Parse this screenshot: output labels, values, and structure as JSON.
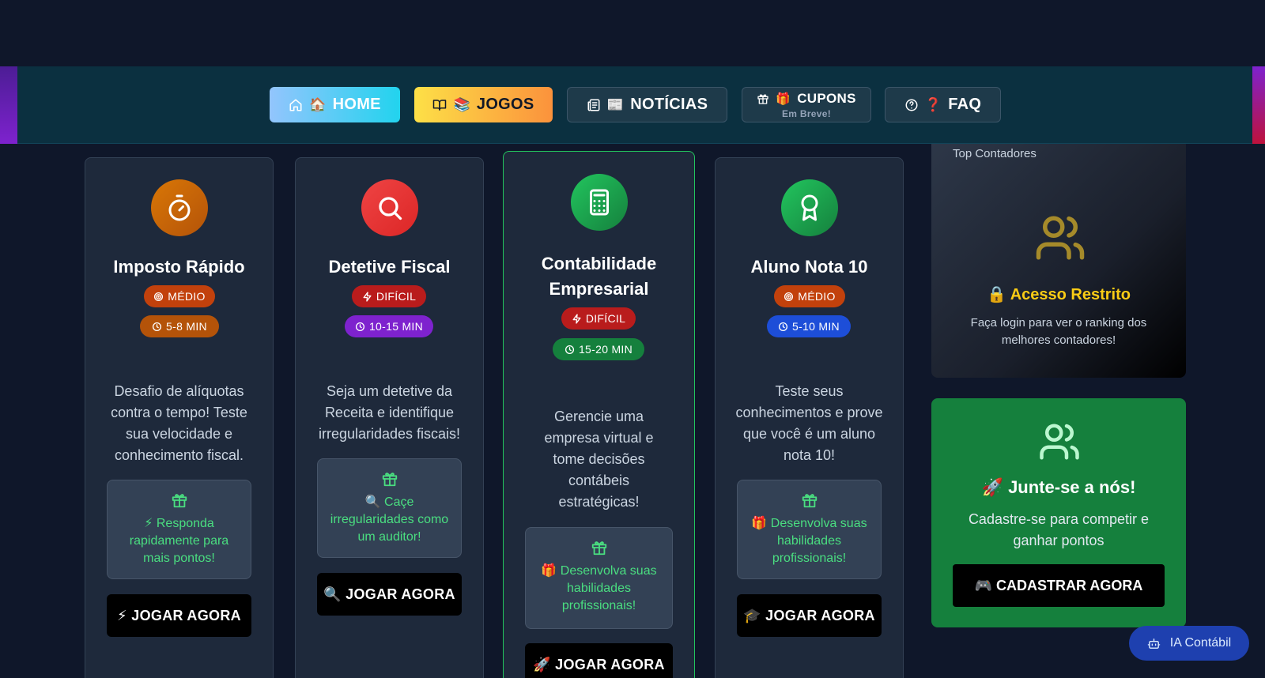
{
  "nav": {
    "home": {
      "emoji": "🏠",
      "label": "HOME"
    },
    "jogos": {
      "emoji": "📚",
      "label": "JOGOS"
    },
    "noticias": {
      "emoji": "📰",
      "label": "NOTÍCIAS"
    },
    "cupons": {
      "emoji": "🎁",
      "label": "CUPONS",
      "sublabel": "Em Breve!"
    },
    "faq": {
      "emoji": "❓",
      "label": "FAQ"
    }
  },
  "games": [
    {
      "title": "Imposto Rápido",
      "difficulty": "MÉDIO",
      "duration": "5-8 MIN",
      "description": "Desafio de alíquotas contra o tempo! Teste sua velocidade e conhecimento fiscal.",
      "tip": "⚡ Responda rapidamente para mais pontos!",
      "button": "⚡ JOGAR AGORA",
      "icon": "stopwatch-icon",
      "icon_color": "#ca8a04"
    },
    {
      "title": "Detetive Fiscal",
      "difficulty": "DIFÍCIL",
      "duration": "10-15 MIN",
      "description": "Seja um detetive da Receita e identifique irregularidades fiscais!",
      "tip": "🔍 Caçe irregularidades como um auditor!",
      "button": "🔍 JOGAR AGORA",
      "icon": "search-icon",
      "icon_color": "#dc2626"
    },
    {
      "title": "Contabilidade Empresarial",
      "difficulty": "DIFÍCIL",
      "duration": "15-20 MIN",
      "description": "Gerencie uma empresa virtual e tome decisões contábeis estratégicas!",
      "tip": "🎁 Desenvolva suas habilidades profissionais!",
      "button": "🚀 JOGAR AGORA",
      "icon": "calculator-icon",
      "icon_color": "#16a34a"
    },
    {
      "title": "Aluno Nota 10",
      "difficulty": "MÉDIO",
      "duration": "5-10 MIN",
      "description": "Teste seus conhecimentos e prove que você é um aluno nota 10!",
      "tip": "🎁 Desenvolva suas habilidades profissionais!",
      "button": "🎓 JOGAR AGORA",
      "icon": "award-icon",
      "icon_color": "#16a34a"
    }
  ],
  "ranking": {
    "label": "Top Contadores",
    "title": "🔒 Acesso Restrito",
    "text": "Faça login para ver o ranking dos melhores contadores!"
  },
  "join": {
    "title": "🚀 Junte-se a nós!",
    "text": "Cadastre-se para competir e ganhar pontos",
    "button": "🎮 CADASTRAR AGORA"
  },
  "ai_button": {
    "label": "IA Contábil"
  },
  "colors": {
    "background": "#0f172a",
    "card": "#1e293b",
    "accent_green": "#4ade80",
    "badge_medio": "#c2410c",
    "badge_dificil": "#b91c1c",
    "restricted_yellow": "#facc15"
  }
}
